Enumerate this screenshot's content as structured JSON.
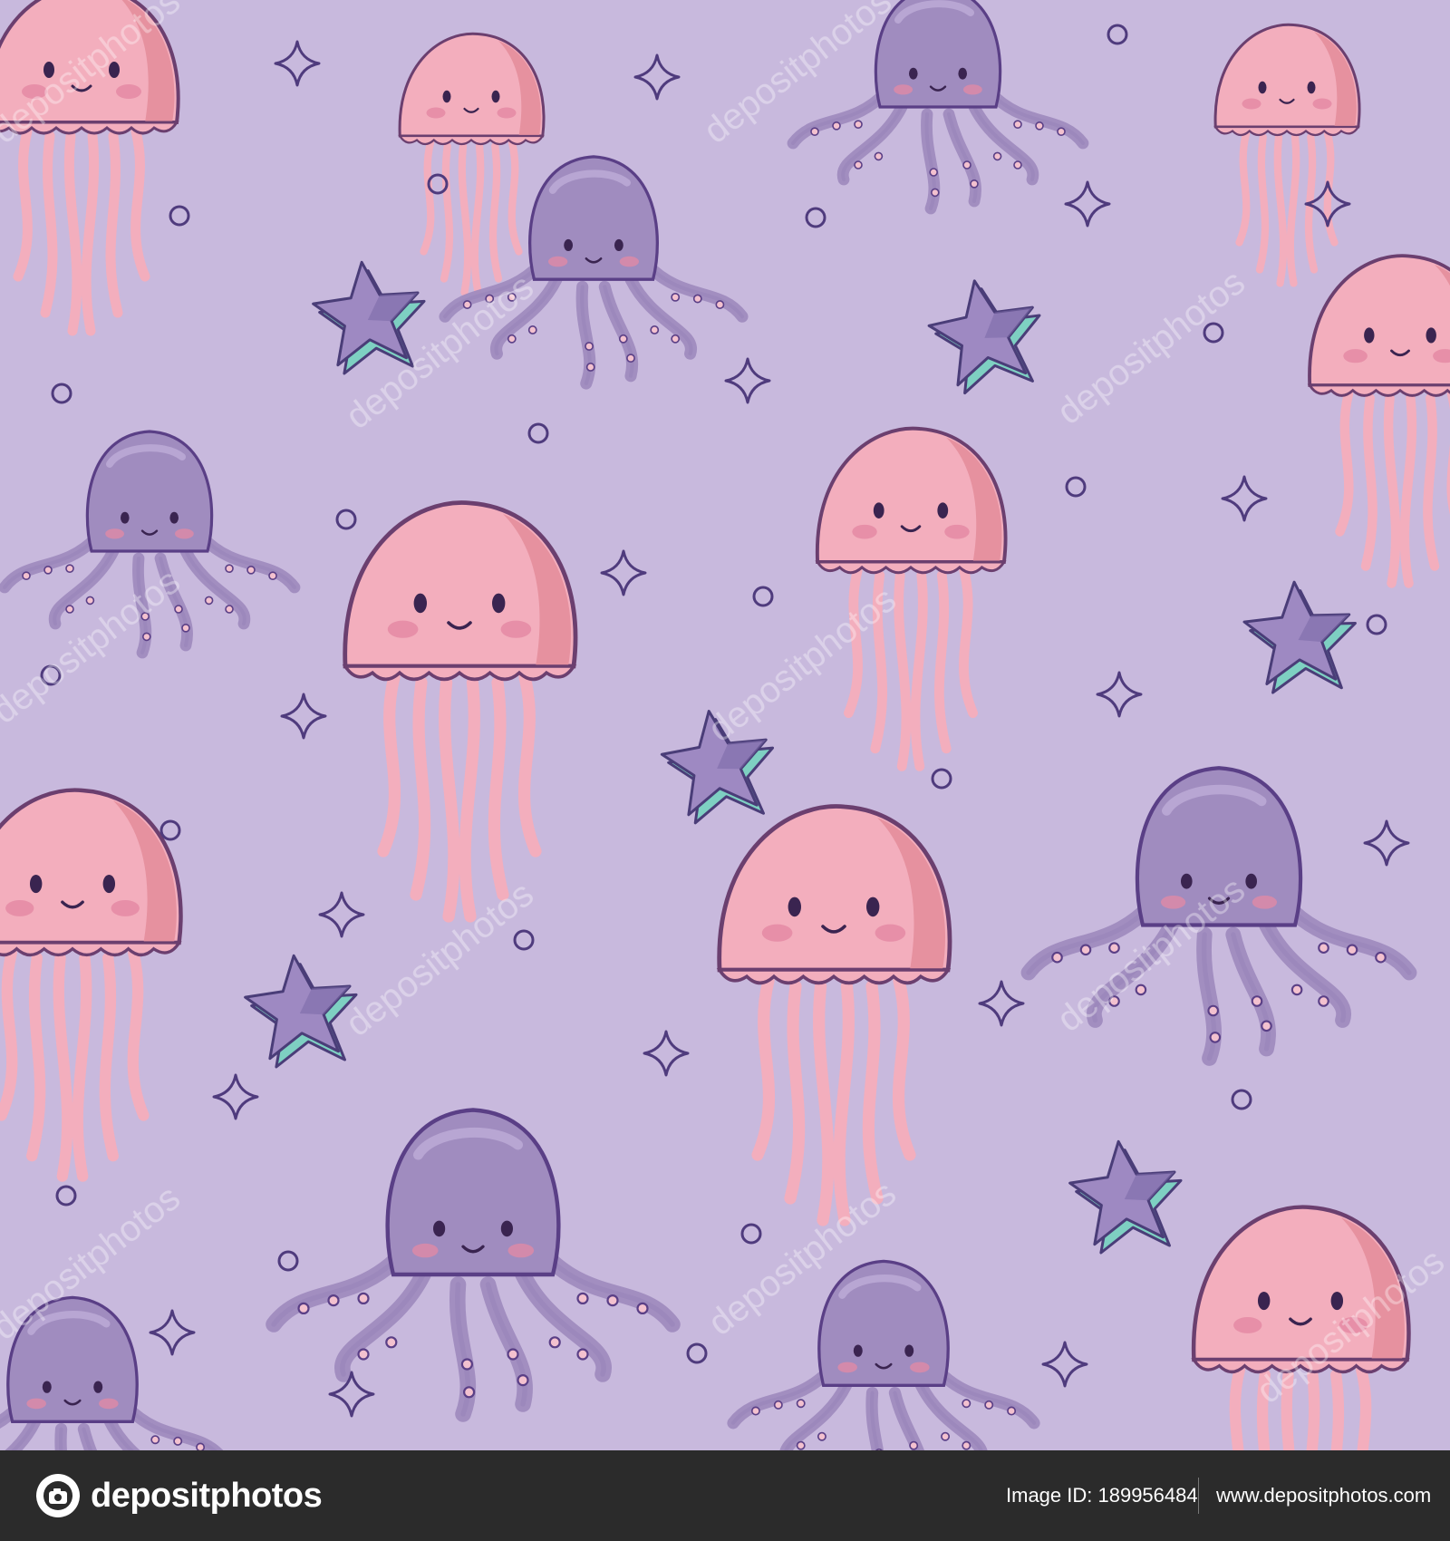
{
  "colors": {
    "background": "#c8b9dd",
    "octopus_body": "#a08cbf",
    "octopus_outline": "#5a3f86",
    "jellyfish_body": "#f3aebd",
    "jellyfish_shade": "#e6919f",
    "jellyfish_outline": "#6b3f6f",
    "star_face": "#9e89c2",
    "star_side": "#7ed0c2",
    "blush": "#e48aa4",
    "footer_background": "#2b2b2b"
  },
  "watermark": {
    "text": "depositphotos"
  },
  "footer": {
    "brand_name": "depositphotos",
    "image_id": "Image ID: 189956484",
    "site_url": "www.depositphotos.com"
  }
}
